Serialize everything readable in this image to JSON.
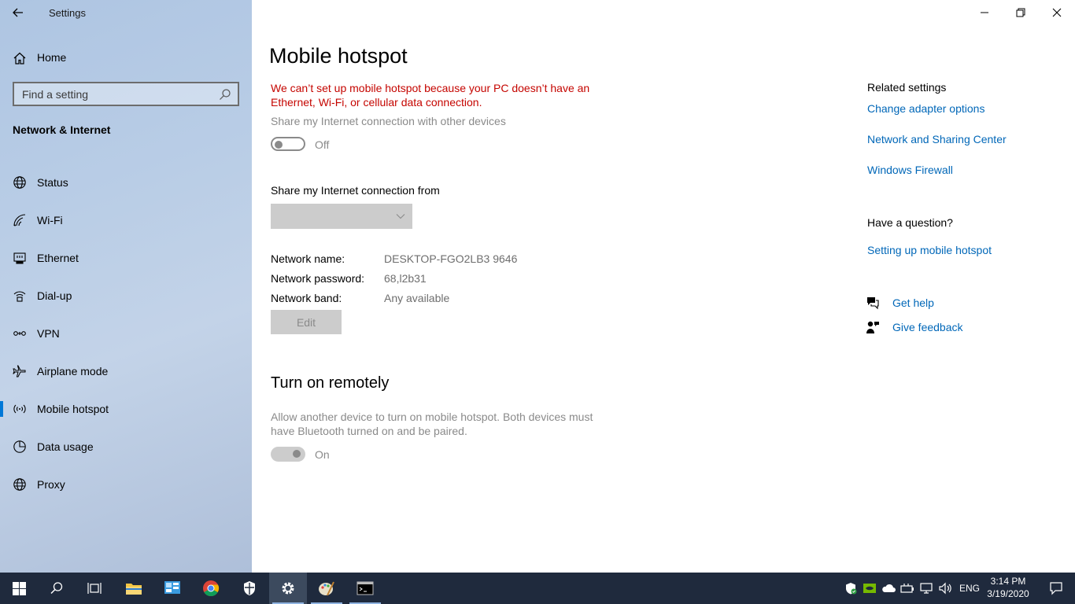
{
  "window": {
    "title": "Settings"
  },
  "sidebar": {
    "home_label": "Home",
    "search_placeholder": "Find a setting",
    "section_title": "Network & Internet",
    "items": [
      {
        "label": "Status",
        "icon": "globe-icon"
      },
      {
        "label": "Wi-Fi",
        "icon": "wifi-icon"
      },
      {
        "label": "Ethernet",
        "icon": "ethernet-icon"
      },
      {
        "label": "Dial-up",
        "icon": "dialup-icon"
      },
      {
        "label": "VPN",
        "icon": "vpn-icon"
      },
      {
        "label": "Airplane mode",
        "icon": "airplane-icon"
      },
      {
        "label": "Mobile hotspot",
        "icon": "hotspot-icon",
        "active": true
      },
      {
        "label": "Data usage",
        "icon": "data-usage-icon"
      },
      {
        "label": "Proxy",
        "icon": "globe-icon"
      }
    ]
  },
  "main": {
    "title": "Mobile hotspot",
    "error": "We can’t set up mobile hotspot because your PC doesn’t have an Ethernet, Wi-Fi, or cellular data connection.",
    "share_label": "Share my Internet connection with other devices",
    "share_toggle_state": "Off",
    "share_from_label": "Share my Internet connection from",
    "share_from_value": "",
    "network_name_label": "Network name:",
    "network_name_value": "DESKTOP-FGO2LB3 9646",
    "network_password_label": "Network password:",
    "network_password_value": "68,l2b31",
    "network_band_label": "Network band:",
    "network_band_value": "Any available",
    "edit_label": "Edit",
    "remote_title": "Turn on remotely",
    "remote_desc": "Allow another device to turn on mobile hotspot. Both devices must have Bluetooth turned on and be paired.",
    "remote_toggle_state": "On"
  },
  "related": {
    "heading": "Related settings",
    "links": [
      "Change adapter options",
      "Network and Sharing Center",
      "Windows Firewall"
    ],
    "question_heading": "Have a question?",
    "question_link": "Setting up mobile hotspot",
    "get_help": "Get help",
    "give_feedback": "Give feedback"
  },
  "taskbar": {
    "language": "ENG",
    "time": "3:14 PM",
    "date": "3/19/2020"
  },
  "colors": {
    "accent": "#0078d7",
    "link": "#0067b8",
    "error": "#c50500",
    "taskbar": "#1f2a3d"
  }
}
